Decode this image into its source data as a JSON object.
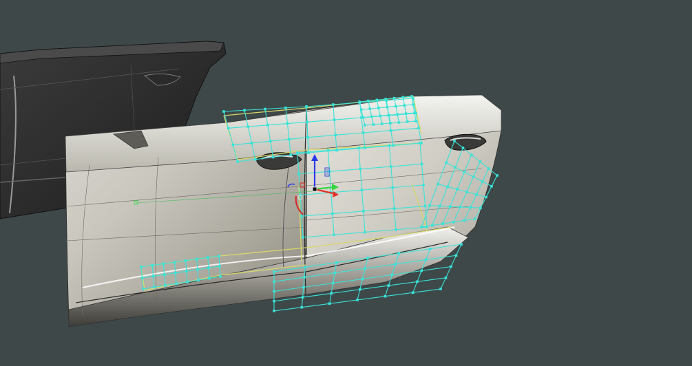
{
  "viewport": {
    "background": "#3e4849",
    "accent_cv_color": "#38e4d8",
    "boundary_color": "#d8d86a"
  },
  "gizmo": {
    "x_axis_color": "#e0342a",
    "y_axis_color": "#34d640",
    "z_axis_color": "#2a3ae8",
    "rotate_arc_color": "#d02a2a"
  },
  "icons": [
    "move-gizmo-icon",
    "pivot-icon",
    "control-vertex-icon"
  ]
}
